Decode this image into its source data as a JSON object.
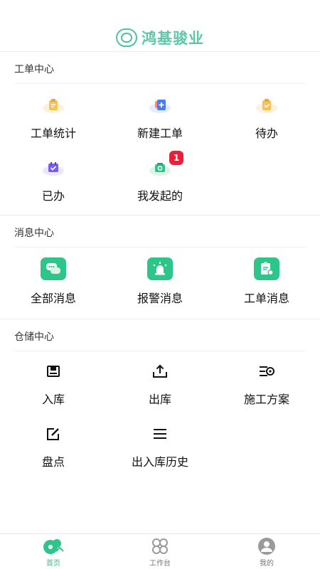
{
  "app": {
    "brand": "鸿基骏业"
  },
  "work_order": {
    "title": "工单中心",
    "items": [
      {
        "label": "工单统计",
        "icon": "clipboard-stats-icon"
      },
      {
        "label": "新建工单",
        "icon": "new-order-icon"
      },
      {
        "label": "待办",
        "icon": "pending-icon"
      },
      {
        "label": "已办",
        "icon": "done-icon"
      },
      {
        "label": "我发起的",
        "icon": "initiated-icon",
        "badge": "1"
      }
    ]
  },
  "messages": {
    "title": "消息中心",
    "items": [
      {
        "label": "全部消息",
        "icon": "chat-bubbles-icon"
      },
      {
        "label": "报警消息",
        "icon": "alarm-light-icon"
      },
      {
        "label": "工单消息",
        "icon": "clipboard-message-icon"
      }
    ]
  },
  "storage": {
    "title": "仓储中心",
    "items": [
      {
        "label": "入库",
        "icon": "inbound-icon"
      },
      {
        "label": "出库",
        "icon": "outbound-icon"
      },
      {
        "label": "施工方案",
        "icon": "plan-icon"
      },
      {
        "label": "盘点",
        "icon": "inventory-check-icon"
      },
      {
        "label": "出入库历史",
        "icon": "history-list-icon"
      }
    ]
  },
  "tabbar": {
    "items": [
      {
        "label": "首页",
        "icon": "home-icon",
        "active": true
      },
      {
        "label": "工作台",
        "icon": "workbench-icon",
        "active": false
      },
      {
        "label": "我的",
        "icon": "profile-icon",
        "active": false
      }
    ]
  },
  "colors": {
    "brand": "#5fc7a8",
    "accent": "#2ec58a",
    "badge": "#e8203a"
  }
}
